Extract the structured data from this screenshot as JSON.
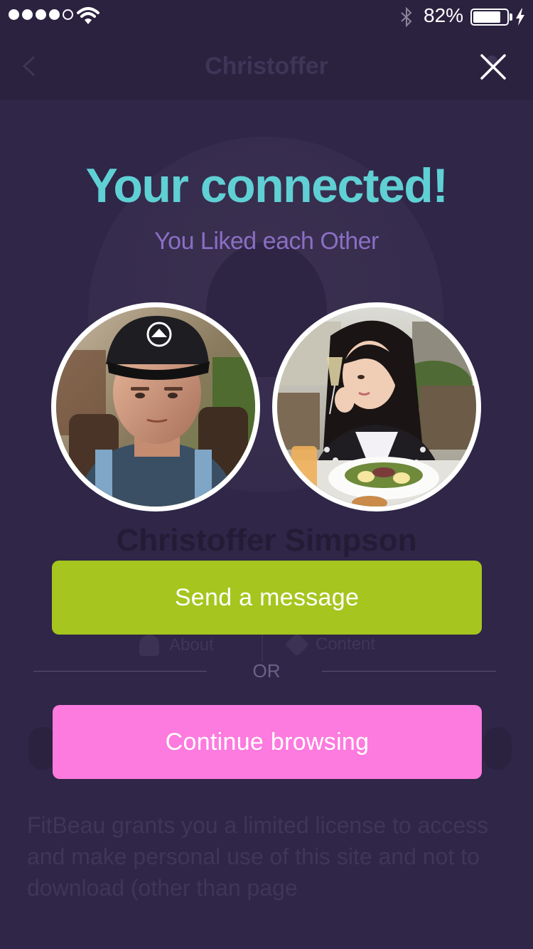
{
  "status_bar": {
    "signal_bars_filled": 4,
    "signal_bars_total": 5,
    "wifi_icon": "wifi-icon",
    "bluetooth_icon": "bluetooth-icon",
    "battery_percent_label": "82%",
    "battery_level": 0.82,
    "charging_icon": "lightning-icon"
  },
  "background_page": {
    "nav_title": "Christoffer",
    "back_icon": "chevron-left-icon",
    "profile_name": "Christoffer Simpson",
    "tabs": [
      {
        "label": "About",
        "icon": "person-icon"
      },
      {
        "label": "Content",
        "icon": "tag-icon"
      }
    ],
    "paragraph": "FitBeau grants you a limited license to access and make personal use of this site and not to download (other than page"
  },
  "modal": {
    "close_icon": "close-icon",
    "headline": "Your connected!",
    "subheadline": "You Liked each Other",
    "photos": [
      {
        "name": "user-photo",
        "alt": "man-in-cap-photo"
      },
      {
        "name": "match-photo",
        "alt": "woman-at-restaurant-photo"
      }
    ],
    "primary_button": "Send a message",
    "divider_label": "OR",
    "secondary_button": "Continue browsing"
  },
  "colors": {
    "overlay_bg": "#2f2648",
    "headline": "#5fd0d4",
    "subheadline": "#8a6fc4",
    "primary_button": "#a6c51e",
    "secondary_button": "#fd7adf"
  }
}
